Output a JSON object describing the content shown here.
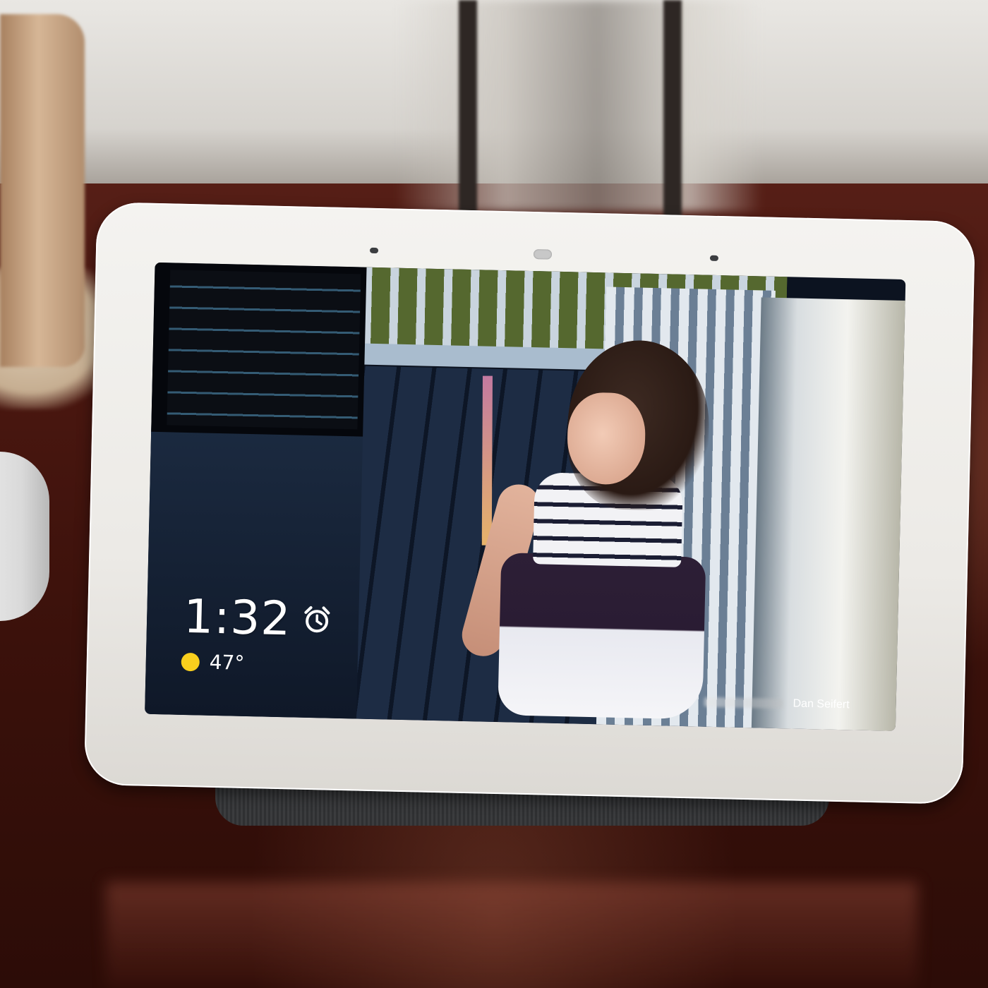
{
  "display": {
    "clock": "1:32",
    "temperature": "47°",
    "photo_credit": "Dan Seifert"
  },
  "icons": {
    "alarm": "alarm-clock-icon",
    "weather": "sun-icon"
  },
  "colors": {
    "sun": "#f9cf1d",
    "screen_text": "#ffffff",
    "device_bezel": "#eceae6"
  }
}
